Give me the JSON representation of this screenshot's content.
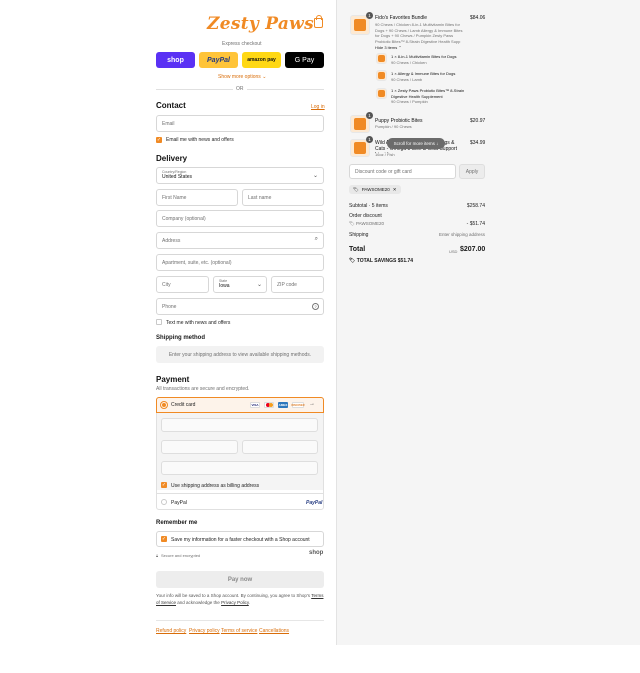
{
  "brand": {
    "logo_text": "Zesty Paws",
    "accent_color": "#f08a24"
  },
  "express": {
    "label": "Express checkout",
    "buttons": [
      "shop",
      "PayPal",
      "amazon pay",
      "G Pay"
    ],
    "more_options": "Show more options",
    "divider": "OR"
  },
  "contact": {
    "title": "Contact",
    "login_link": "Log in",
    "email_placeholder": "Email",
    "news_label": "Email me with news and offers"
  },
  "delivery": {
    "title": "Delivery",
    "country_label": "Country/Region",
    "country_value": "United States",
    "first_name": "First Name",
    "last_name": "Last name",
    "company": "Company (optional)",
    "address": "Address",
    "apartment": "Apartment, suite, etc. (optional)",
    "city": "City",
    "state_label": "State",
    "state_value": "Iowa",
    "zip": "ZIP code",
    "phone": "Phone",
    "text_news": "Text me with news and offers"
  },
  "shipping": {
    "title": "Shipping method",
    "note": "Enter your shipping address to view available shipping methods."
  },
  "payment": {
    "title": "Payment",
    "subtitle": "All transactions are secure and encrypted.",
    "credit_card": "Credit card",
    "card_brands": [
      "VISA",
      "MC",
      "AMEX",
      "DISCOVER"
    ],
    "billing_same": "Use shipping address as billing address",
    "paypal": "PayPal"
  },
  "remember": {
    "title": "Remember me",
    "save_label": "Save my information for a faster checkout with a Shop account",
    "secure": "Secure and encrypted",
    "shop_logo": "shop"
  },
  "pay_now": "Pay now",
  "fine_print": {
    "pre": "Your info will be saved to a Shop account. By continuing, you agree to Shop's",
    "terms": "Terms of Service",
    "mid": "and acknowledge the",
    "privacy": "Privacy Policy",
    "end": "."
  },
  "footer_links": [
    "Refund policy",
    "Privacy policy",
    "Terms of service",
    "Cancellations"
  ],
  "cart": {
    "bundle": {
      "qty": "1",
      "name": "Fido's Favorites Bundle",
      "desc": "90 Chews / Chicken 8-in-1 Multivitamin Bites for Dogs + 90 Chews / Lamb Allergy & Immune Bites for Dogs + 90 Chews / Pumpkin Zesty Paws Probiotic Bites™ 8-Strain Digestive Health Supp",
      "price": "$84.06",
      "toggle": "Hide 3 items"
    },
    "sub_items": [
      {
        "name": "1 × 8-in-1 Multivitamin Bites for Dogs",
        "variant": "90 Chews / Chicken"
      },
      {
        "name": "1 × Allergy & Immune Bites for Dogs",
        "variant": "90 Chews / Lamb"
      },
      {
        "name": "1 × Zesty Paws Probiotic Bites™ 8-Strain Digestive Health Supplement",
        "variant": "90 Chews / Pumpkin"
      }
    ],
    "items": [
      {
        "qty": "1",
        "name": "Puppy Probiotic Bites",
        "variant": "Pumpkin / 90 Chews",
        "price": "$20.97"
      },
      {
        "qty": "1",
        "name": "Wild Alaskan Salmon Oil for Dogs & Cats - Omega 3 Skin & Coat Support Liquid",
        "variant": "16oz / Fish",
        "price": "$34.99"
      }
    ],
    "scroll_hint": "Scroll for more items",
    "discount_placeholder": "Discount code or gift card",
    "apply": "Apply",
    "code_chip": "PAWSOME20",
    "subtotal_label": "Subtotal · 5 items",
    "subtotal_value": "$258.74",
    "order_discount_label": "Order discount",
    "order_discount_code": "PAWSOME20",
    "order_discount_value": "- $51.74",
    "shipping_label": "Shipping",
    "shipping_value": "Enter shipping address",
    "total_label": "Total",
    "currency": "USD",
    "total_value": "$207.00",
    "savings": "TOTAL SAVINGS $51.74"
  }
}
